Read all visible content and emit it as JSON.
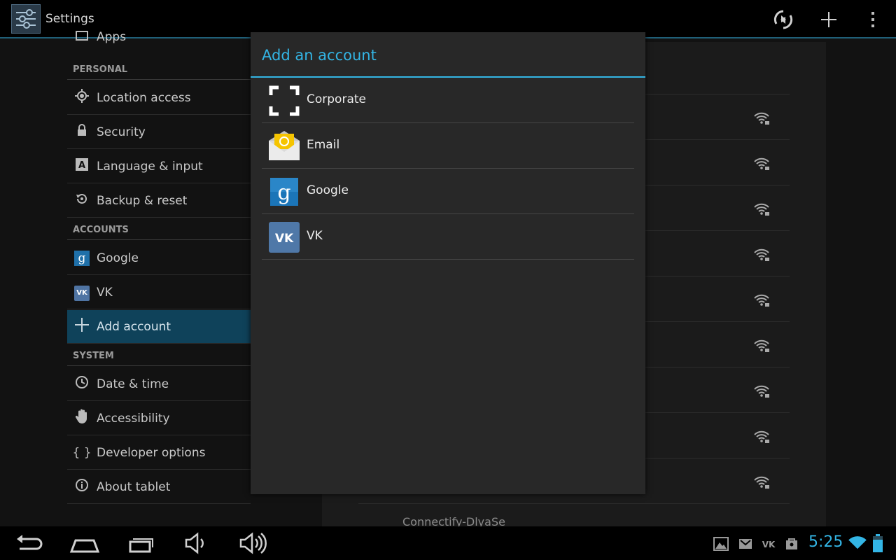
{
  "action_bar": {
    "title": "Settings",
    "icons": [
      "settings-app-icon",
      "sync-icon",
      "add-icon",
      "overflow-menu-icon"
    ]
  },
  "left_pane": {
    "partial_item_label": "Apps",
    "sections": [
      {
        "header": "PERSONAL",
        "items": [
          {
            "label": "Location access",
            "icon": "location-icon"
          },
          {
            "label": "Security",
            "icon": "lock-icon"
          },
          {
            "label": "Language & input",
            "icon": "language-icon"
          },
          {
            "label": "Backup & reset",
            "icon": "backup-icon"
          }
        ]
      },
      {
        "header": "ACCOUNTS",
        "items": [
          {
            "label": "Google",
            "icon": "google-icon"
          },
          {
            "label": "VK",
            "icon": "vk-icon"
          },
          {
            "label": "Add account",
            "icon": "plus-icon",
            "selected": true
          }
        ]
      },
      {
        "header": "SYSTEM",
        "items": [
          {
            "label": "Date & time",
            "icon": "clock-icon"
          },
          {
            "label": "Accessibility",
            "icon": "hand-icon"
          },
          {
            "label": "Developer options",
            "icon": "braces-icon",
            "glyph": "{ }"
          },
          {
            "label": "About tablet",
            "icon": "info-icon"
          }
        ]
      }
    ]
  },
  "right_pane": {
    "bottom_partial_label": "Connectify-DlyaSe"
  },
  "dialog": {
    "title": "Add an account",
    "items": [
      {
        "label": "Corporate",
        "icon": "corporate-icon"
      },
      {
        "label": "Email",
        "icon": "email-icon"
      },
      {
        "label": "Google",
        "icon": "google-icon"
      },
      {
        "label": "VK",
        "icon": "vk-icon"
      }
    ]
  },
  "nav_bar": {
    "buttons": [
      "back-icon",
      "home-icon",
      "recent-apps-icon",
      "volume-down-icon",
      "volume-up-icon"
    ]
  },
  "status_bar": {
    "time": "5:25",
    "notification_icons": [
      "gallery-icon",
      "gmail-icon",
      "vk-icon",
      "store-icon"
    ],
    "accent_color": "#33b5e5"
  }
}
